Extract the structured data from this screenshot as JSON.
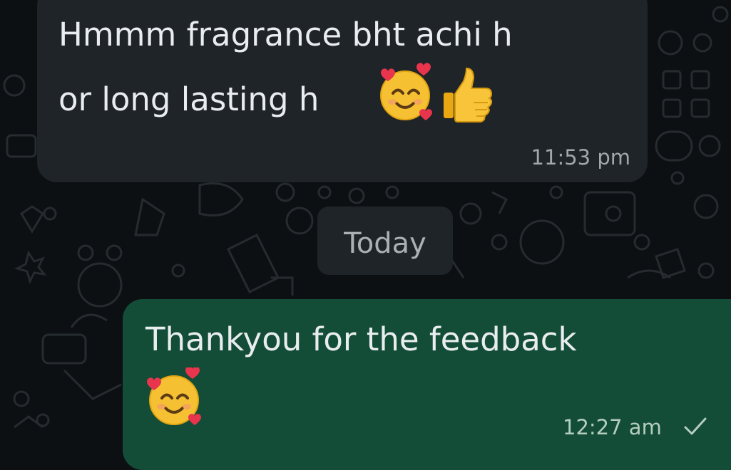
{
  "chat": {
    "incoming": {
      "line1": "Hmmm fragrance bht achi h",
      "line2": "or long lasting h",
      "emojis": [
        "smiling-face-with-hearts-icon",
        "thumbs-up-icon"
      ],
      "time": "11:53 pm"
    },
    "date_separator": "Today",
    "outgoing": {
      "line1": "Thankyou for the feedback",
      "emojis": [
        "smiling-face-with-hearts-icon"
      ],
      "time": "12:27 am",
      "status_icon": "single-check-icon"
    }
  },
  "colors": {
    "background": "#0c1013",
    "incoming_bubble": "#1f2428",
    "outgoing_bubble": "#134d37",
    "text": "#e9edef"
  }
}
